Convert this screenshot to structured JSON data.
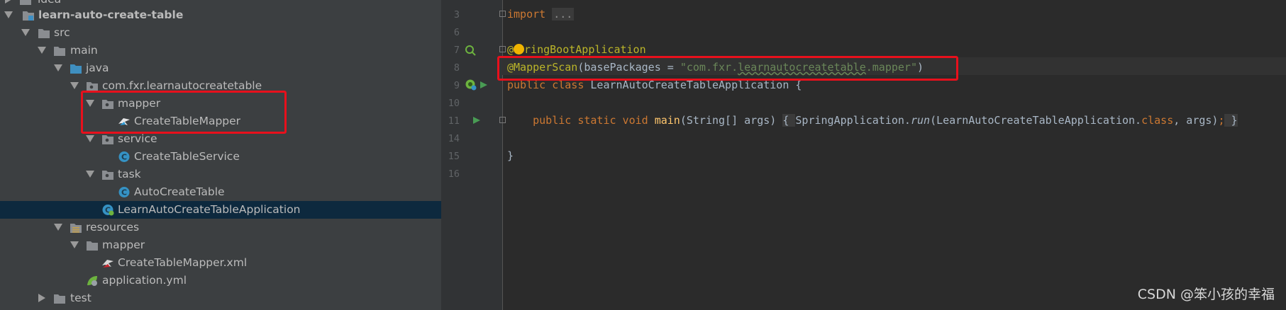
{
  "project_tree": {
    "items": [
      {
        "label": "idea"
      },
      {
        "label": "learn-auto-create-table"
      },
      {
        "label": "src"
      },
      {
        "label": "main"
      },
      {
        "label": "java"
      },
      {
        "label": "com.fxr.learnautocreatetable"
      },
      {
        "label": "mapper"
      },
      {
        "label": "CreateTableMapper"
      },
      {
        "label": "service"
      },
      {
        "label": "CreateTableService"
      },
      {
        "label": "task"
      },
      {
        "label": "AutoCreateTable"
      },
      {
        "label": "LearnAutoCreateTableApplication"
      },
      {
        "label": "resources"
      },
      {
        "label": "mapper"
      },
      {
        "label": "CreateTableMapper.xml"
      },
      {
        "label": "application.yml"
      },
      {
        "label": "test"
      }
    ],
    "selected": "LearnAutoCreateTableApplication"
  },
  "editor": {
    "line_numbers": [
      "3",
      "6",
      "7",
      "8",
      "9",
      "10",
      "11",
      "14",
      "15",
      "16"
    ],
    "lines": {
      "l3_import": "import",
      "l3_folded": "...",
      "l7_at": "@",
      "l7_rest": "ringBootApplication",
      "l8_ann": "@MapperScan",
      "l8_open": "(basePackages = ",
      "l8_str1": "\"com.fxr.",
      "l8_str2": "learnautocreatetable",
      "l8_str3": ".mapper\"",
      "l8_close": ")",
      "l9_kw": "public class ",
      "l9_name": "LearnAutoCreateTableApplication {",
      "l11_kw": "public static void ",
      "l11_fn": "main",
      "l11_args": "(String[] args) ",
      "l11_brace1": "{ ",
      "l11_call1": "SpringApplication.",
      "l11_run": "run",
      "l11_call2": "(LearnAutoCreateTableApplication.",
      "l11_class": "class",
      "l11_call3": ", args)",
      "l11_semi": ";",
      "l11_brace2": " }",
      "l15": "}"
    }
  },
  "colors": {
    "highlight_box": "#e8101c",
    "keyword": "#cc7832",
    "annotation": "#bbb529",
    "string": "#6a8759",
    "method": "#ffc66d"
  },
  "watermark": "CSDN @笨小孩的幸福"
}
